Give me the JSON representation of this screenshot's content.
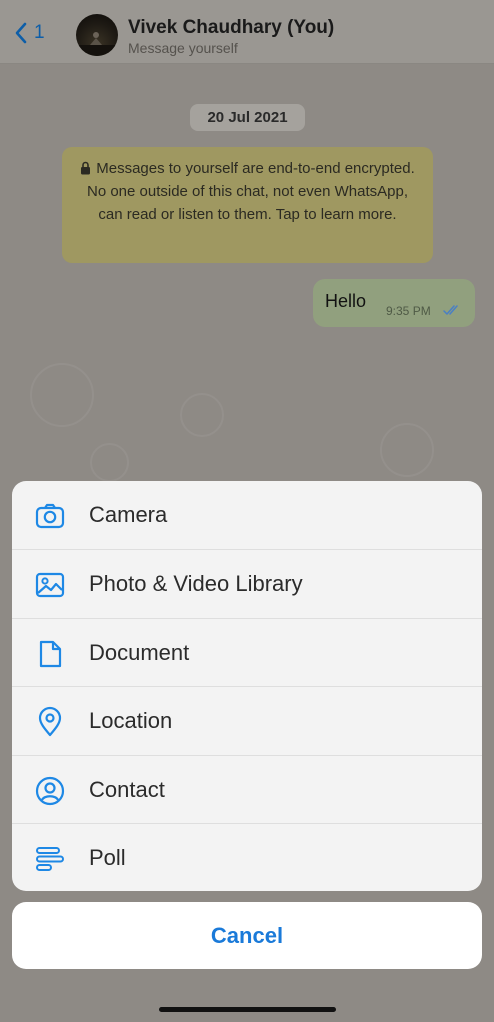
{
  "header": {
    "back_count": "1",
    "title": "Vivek Chaudhary (You)",
    "subtitle": "Message yourself"
  },
  "chat": {
    "date": "20 Jul 2021",
    "notice": "Messages to yourself are end-to-end encrypted. No one outside of this chat, not even WhatsApp, can read or listen to them. Tap to learn more.",
    "messages": [
      {
        "text": "Hello",
        "time": "9:35 PM",
        "status": "read-double-tick-icon"
      }
    ]
  },
  "action_sheet": {
    "items": [
      {
        "label": "Camera",
        "icon": "camera-icon"
      },
      {
        "label": "Photo & Video Library",
        "icon": "photo-icon"
      },
      {
        "label": "Document",
        "icon": "document-icon"
      },
      {
        "label": "Location",
        "icon": "location-pin-icon"
      },
      {
        "label": "Contact",
        "icon": "contact-icon"
      },
      {
        "label": "Poll",
        "icon": "poll-icon"
      }
    ],
    "cancel_label": "Cancel"
  },
  "colors": {
    "accent": "#1a7ad9",
    "icon_blue": "#1e88e5",
    "outgoing_bubble": "#91a07e",
    "notice_bg": "#9f9861"
  }
}
